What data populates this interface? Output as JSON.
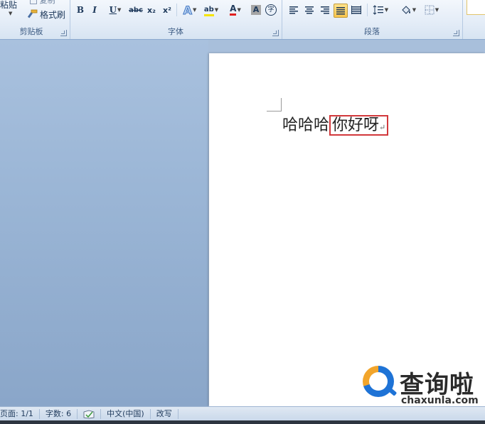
{
  "ribbon": {
    "clipboard": {
      "paste_label": "粘贴",
      "copy_label": "复制",
      "format_painter_label": "格式刷",
      "group_label": "剪贴板"
    },
    "font": {
      "group_label": "字体",
      "bold": "B",
      "italic": "I",
      "underline": "U",
      "strikethrough": "abc",
      "subscript": "x₂",
      "superscript": "x²",
      "text_effect": "A",
      "highlight": "ab",
      "font_color": "A",
      "char_shading": "A",
      "enclose": "字"
    },
    "paragraph": {
      "group_label": "段落"
    }
  },
  "document": {
    "text_plain": "哈哈哈",
    "text_selected": "你好呀",
    "paragraph_mark": "↵"
  },
  "watermark": {
    "title": "查询啦",
    "subtitle": "chaxunla.com"
  },
  "statusbar": {
    "page": "页面: 1/1",
    "word_count": "字数: 6",
    "language": "中文(中国)",
    "mode": "改写"
  },
  "colors": {
    "selection_box": "#d2383b",
    "font_color_underline": "#e02020",
    "highlight_underline": "#f5e400"
  }
}
